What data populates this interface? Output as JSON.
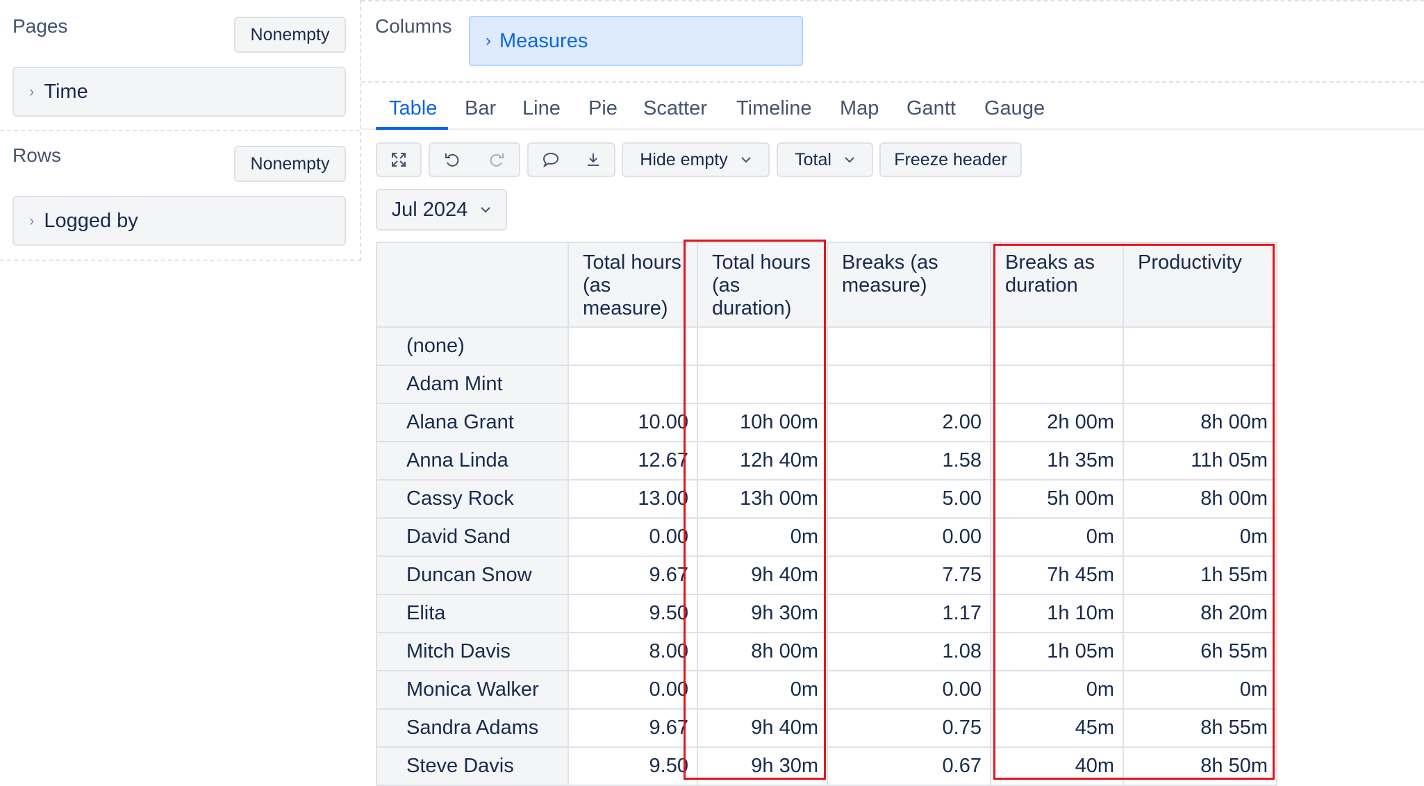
{
  "left_panel": {
    "pages": {
      "label": "Pages",
      "nonempty_label": "Nonempty",
      "dimension": "Time"
    },
    "rows": {
      "label": "Rows",
      "nonempty_label": "Nonempty",
      "dimension": "Logged by"
    }
  },
  "columns": {
    "label": "Columns",
    "dimension": "Measures"
  },
  "tabs": [
    "Table",
    "Bar",
    "Line",
    "Pie",
    "Scatter",
    "Timeline",
    "Map",
    "Gantt",
    "Gauge"
  ],
  "active_tab": "Table",
  "toolbar": {
    "icons": [
      "fullscreen-icon",
      "undo-icon",
      "redo-icon",
      "comment-icon",
      "download-icon"
    ],
    "hide_empty_label": "Hide empty",
    "total_label": "Total",
    "freeze_header_label": "Freeze header",
    "period_label": "Jul 2024"
  },
  "table": {
    "headers": [
      "Total hours (as measure)",
      "Total hours (as duration)",
      "Breaks (as measure)",
      "Breaks as duration",
      "Productivity"
    ],
    "rows": [
      {
        "name": "(none)",
        "cells": [
          "",
          "",
          "",
          "",
          ""
        ]
      },
      {
        "name": "Adam Mint",
        "cells": [
          "",
          "",
          "",
          "",
          ""
        ]
      },
      {
        "name": "Alana Grant",
        "cells": [
          "10.00",
          "10h 00m",
          "2.00",
          "2h 00m",
          "8h 00m"
        ]
      },
      {
        "name": "Anna Linda",
        "cells": [
          "12.67",
          "12h 40m",
          "1.58",
          "1h 35m",
          "11h 05m"
        ]
      },
      {
        "name": "Cassy Rock",
        "cells": [
          "13.00",
          "13h 00m",
          "5.00",
          "5h 00m",
          "8h 00m"
        ]
      },
      {
        "name": "David Sand",
        "cells": [
          "0.00",
          "0m",
          "0.00",
          "0m",
          "0m"
        ]
      },
      {
        "name": "Duncan Snow",
        "cells": [
          "9.67",
          "9h 40m",
          "7.75",
          "7h 45m",
          "1h 55m"
        ]
      },
      {
        "name": "Elita",
        "cells": [
          "9.50",
          "9h 30m",
          "1.17",
          "1h 10m",
          "8h 20m"
        ]
      },
      {
        "name": "Mitch Davis",
        "cells": [
          "8.00",
          "8h 00m",
          "1.08",
          "1h 05m",
          "6h 55m"
        ]
      },
      {
        "name": "Monica Walker",
        "cells": [
          "0.00",
          "0m",
          "0.00",
          "0m",
          "0m"
        ]
      },
      {
        "name": "Sandra Adams",
        "cells": [
          "9.67",
          "9h 40m",
          "0.75",
          "45m",
          "8h 55m"
        ]
      },
      {
        "name": "Steve Davis",
        "cells": [
          "9.50",
          "9h 30m",
          "0.67",
          "40m",
          "8h 50m"
        ]
      }
    ]
  },
  "colors": {
    "accent": "#0c66e4",
    "highlight": "#e5141b"
  }
}
